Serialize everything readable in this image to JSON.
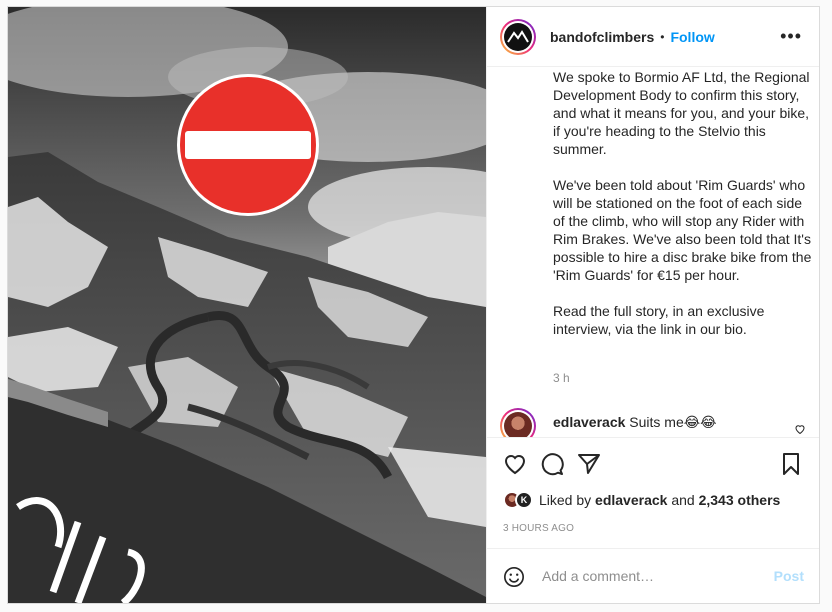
{
  "header": {
    "username": "bandofclimbers",
    "separator": "•",
    "follow_label": "Follow",
    "more_label": "•••"
  },
  "caption": {
    "paragraphs": [
      "We spoke to Bormio AF Ltd, the Regional Development Body to confirm this story, and what it means for you, and your bike, if you're heading to the Stelvio this summer.",
      "We've been told about 'Rim Guards' who will be stationed on the foot of each side of the climb, who will stop any Rider with Rim Brakes. We've also been told that It's possible to hire a disc brake bike from the 'Rim Guards' for €15 per hour.",
      "Read the full story, in an exclusive interview, via the link in our bio."
    ],
    "age": "3 h"
  },
  "comment": {
    "username": "edlaverack",
    "text": " Suits me😂😂"
  },
  "actions": {
    "icons": [
      "heart-icon",
      "comment-icon",
      "share-icon",
      "bookmark-icon"
    ]
  },
  "likes": {
    "prefix": "Liked by ",
    "user": "edlaverack",
    "middle": " and ",
    "count": "2,343 others",
    "avatar2_letter": "K"
  },
  "timestamp": "3 HOURS AGO",
  "add_comment": {
    "placeholder": "Add a comment…",
    "post_label": "Post"
  },
  "colors": {
    "accent": "#0095f6",
    "post_disabled": "#b2dffc",
    "sign_red": "#e8302a"
  }
}
